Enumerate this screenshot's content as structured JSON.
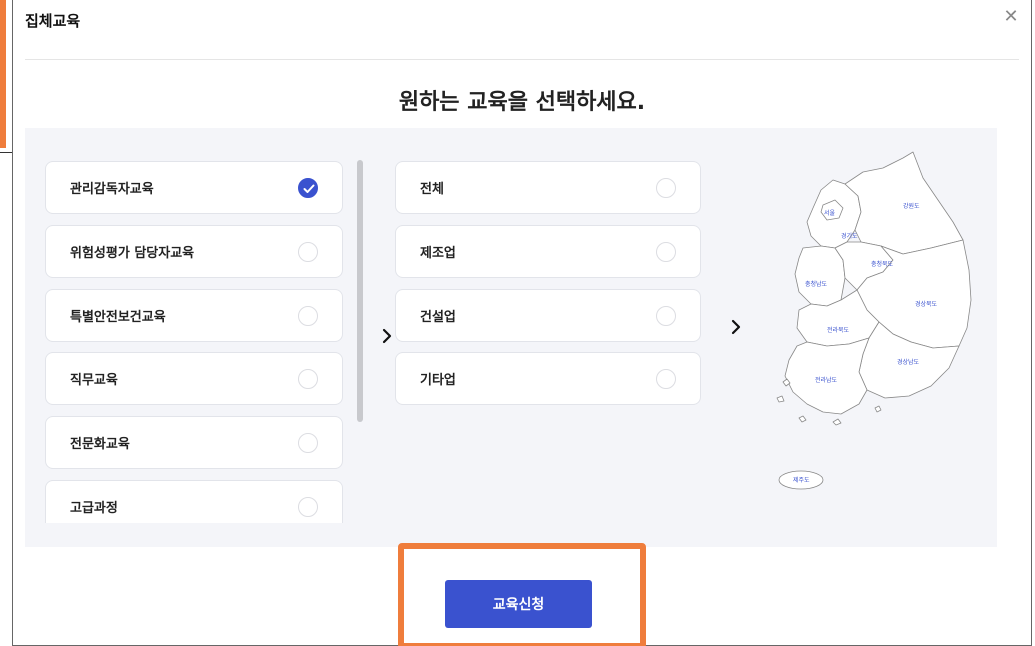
{
  "modal": {
    "title": "집체교육",
    "close_icon": "close-icon",
    "heading": "원하는 교육을 선택하세요."
  },
  "education_types": [
    {
      "label": "관리감독자교육",
      "selected": true
    },
    {
      "label": "위험성평가 담당자교육",
      "selected": false
    },
    {
      "label": "특별안전보건교육",
      "selected": false
    },
    {
      "label": "직무교육",
      "selected": false
    },
    {
      "label": "전문화교육",
      "selected": false
    },
    {
      "label": "고급과정",
      "selected": false
    }
  ],
  "industries": [
    {
      "label": "전체",
      "selected": false
    },
    {
      "label": "제조업",
      "selected": false
    },
    {
      "label": "건설업",
      "selected": false
    },
    {
      "label": "기타업",
      "selected": false
    }
  ],
  "map": {
    "regions": [
      "서울",
      "경기도",
      "강원도",
      "충청북도",
      "충청남도",
      "경상북도",
      "전라북도",
      "경상남도",
      "전라남도",
      "제주도"
    ]
  },
  "actions": {
    "apply_label": "교육신청"
  },
  "colors": {
    "accent": "#3a52cf",
    "highlight": "#ef7d3c",
    "panel_bg": "#f4f5f9"
  }
}
